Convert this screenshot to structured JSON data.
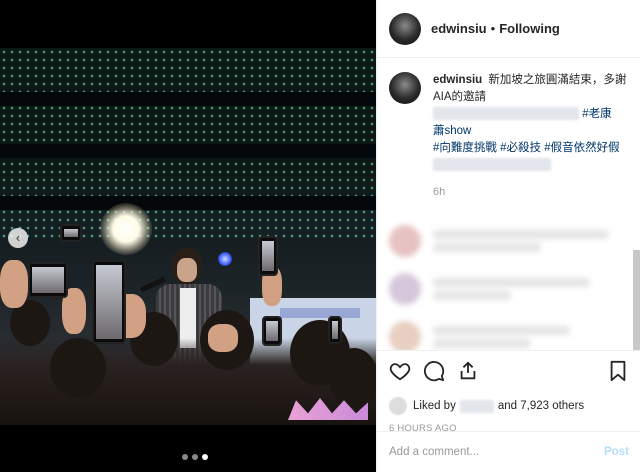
{
  "post": {
    "username": "edwinsiu",
    "follow_status": "Following",
    "caption_text": "新加坡之旅圓滿結束，多謝AIA的邀請",
    "hashtags": [
      "#老康",
      "#向難度挑戰",
      "#必殺技",
      "#假音依然好假"
    ],
    "hashtag_show_fragment": "蕭show",
    "time_since": "6h",
    "liked_by_prefix": "Liked by",
    "liked_by_suffix": "and 7,923 others",
    "timestamp": "6 HOURS AGO",
    "comment_placeholder": "Add a comment...",
    "post_button": "Post"
  },
  "carousel": {
    "slide_count": 3,
    "active_index": 2
  },
  "icons": [
    "heart-icon",
    "comment-icon",
    "share-icon",
    "bookmark-icon",
    "chevron-left-icon",
    "more-icon"
  ]
}
